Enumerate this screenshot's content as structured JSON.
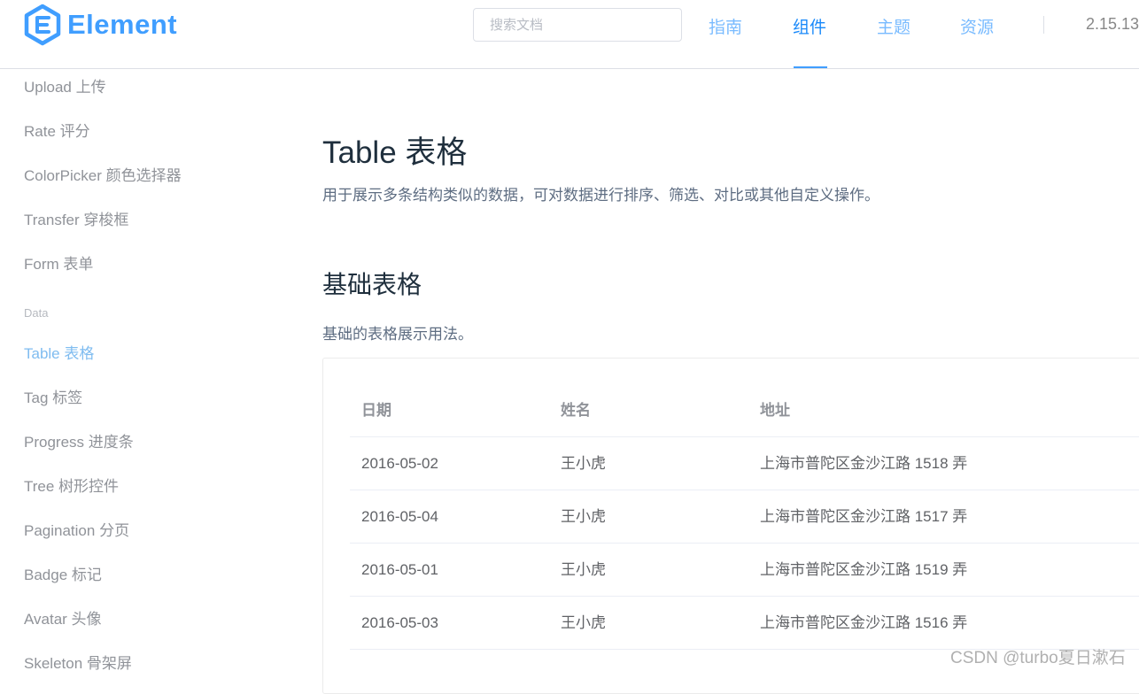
{
  "header": {
    "logo_text": "Element",
    "search_placeholder": "搜索文档",
    "nav": {
      "guide": "指南",
      "component": "组件",
      "theme": "主题",
      "resource": "资源"
    },
    "version": "2.15.13"
  },
  "sidebar": {
    "items_top": [
      "Upload 上传",
      "Rate 评分",
      "ColorPicker 颜色选择器",
      "Transfer 穿梭框",
      "Form 表单"
    ],
    "group_label": "Data",
    "items_data": [
      "Table 表格",
      "Tag 标签",
      "Progress 进度条",
      "Tree 树形控件",
      "Pagination 分页",
      "Badge 标记",
      "Avatar 头像",
      "Skeleton 骨架屏"
    ]
  },
  "main": {
    "title": "Table 表格",
    "description": "用于展示多条结构类似的数据，可对数据进行排序、筛选、对比或其他自定义操作。",
    "section_title": "基础表格",
    "section_description": "基础的表格展示用法。"
  },
  "table": {
    "headers": [
      "日期",
      "姓名",
      "地址"
    ],
    "rows": [
      [
        "2016-05-02",
        "王小虎",
        "上海市普陀区金沙江路 1518 弄"
      ],
      [
        "2016-05-04",
        "王小虎",
        "上海市普陀区金沙江路 1517 弄"
      ],
      [
        "2016-05-01",
        "王小虎",
        "上海市普陀区金沙江路 1519 弄"
      ],
      [
        "2016-05-03",
        "王小虎",
        "上海市普陀区金沙江路 1516 弄"
      ]
    ]
  },
  "watermark": "CSDN @turbo夏日漱石",
  "colors": {
    "brand": "#409eff",
    "nav_inactive": "#79bbff",
    "sidebar_active": "#7fbcf0",
    "title": "#1f2f3d"
  }
}
